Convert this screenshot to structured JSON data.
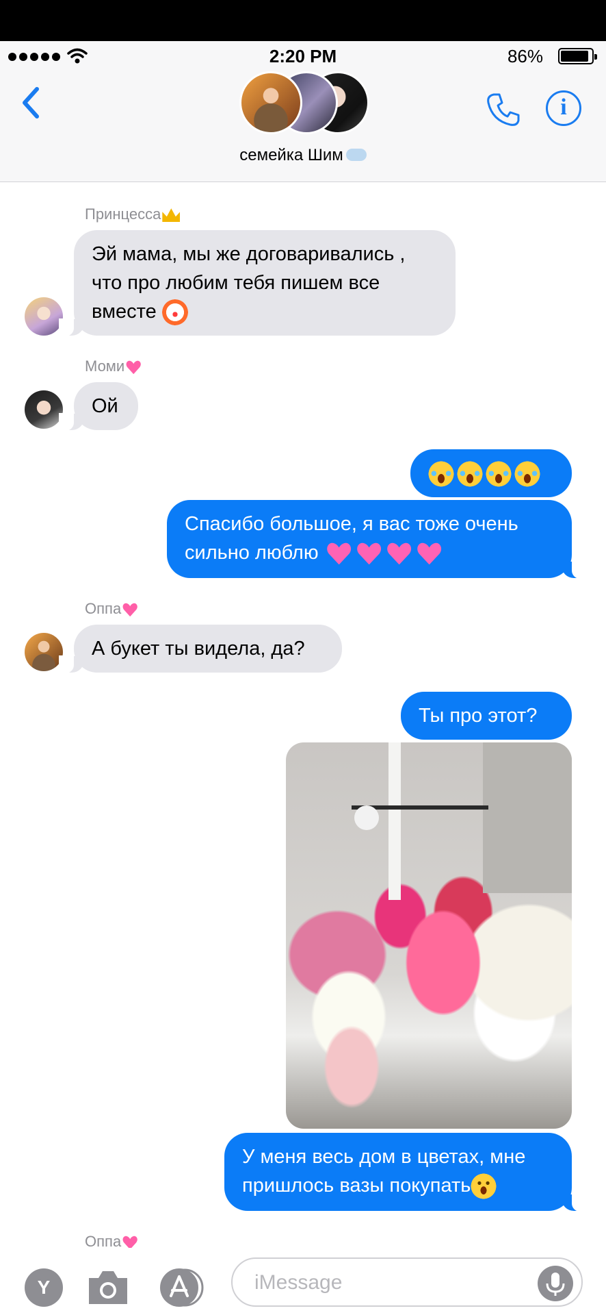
{
  "status_bar": {
    "time": "2:20 PM",
    "battery": "86%"
  },
  "header": {
    "title": "семейка Шим",
    "back_icon": "chevron-left-icon",
    "call_icon": "phone-icon",
    "info_label": "i"
  },
  "messages": [
    {
      "sender": "Принцесса",
      "text": "Эй мама, мы же договаривались , что про любим тебя пишем все вместе"
    },
    {
      "sender": "Моми",
      "text": "Ой"
    },
    {
      "outgoing": true,
      "text": ""
    },
    {
      "outgoing": true,
      "text": "Спасибо большое, я вас тоже очень сильно люблю"
    },
    {
      "sender": "Оппа",
      "text": "А букет ты видела, да?"
    },
    {
      "outgoing": true,
      "text": "Ты про этот?"
    },
    {
      "outgoing": true,
      "text": "photo-flowers"
    },
    {
      "outgoing": true,
      "text": "У меня весь дом в цветах, мне пришлось вазы покупать"
    }
  ],
  "typing_sender": "Оппа",
  "composer": {
    "app_label": "Y",
    "placeholder": "iMessage"
  },
  "colors": {
    "accent": "#0b7cf7",
    "incoming_bubble": "#e5e5ea",
    "sender_label": "#8e8e93"
  }
}
